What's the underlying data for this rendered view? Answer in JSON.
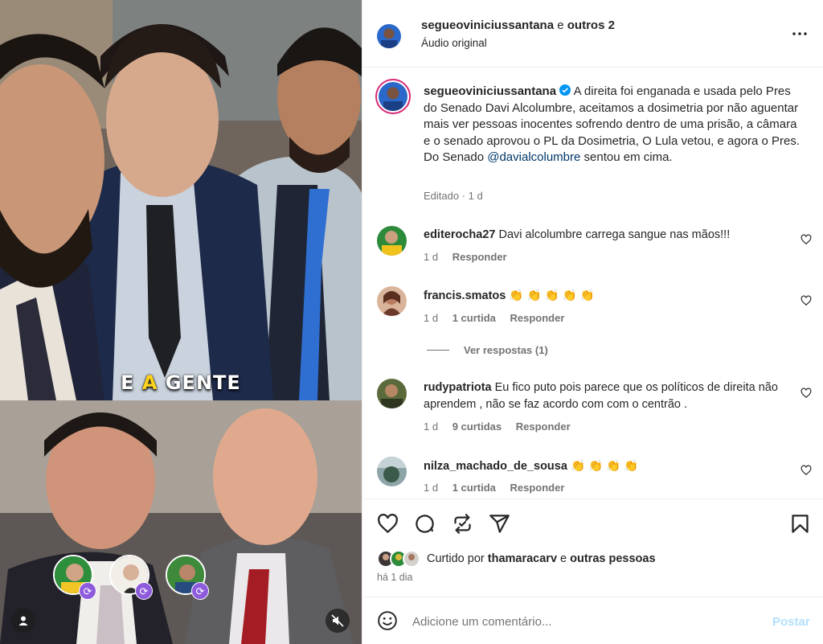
{
  "media": {
    "caption_prefix": "E ",
    "caption_highlight": "A",
    "caption_suffix": " GENTE",
    "collab_badge_icon": "repost-icon"
  },
  "header": {
    "username": "segueoviniciussantana",
    "joiner": " e ",
    "others": "outros 2",
    "audio": "Áudio original",
    "more_icon": "more-horizontal-icon"
  },
  "post_caption": {
    "username": "segueoviniciussantana",
    "verified_icon": "verified-badge-icon",
    "text_before": "A direita foi enganada e usada pelo Pres do Senado Davi Alcolumbre, aceitamos a dosimetria por não aguentar mais ver pessoas inocentes sofrendo dentro de uma prisão, a câmara e o senado aprovou o PL da Dosimetria, O Lula vetou, e agora o Pres. Do Senado ",
    "mention": "@davialcolumbre",
    "text_after": " sentou em cima.",
    "edited": "Editado · 1 d"
  },
  "comments": [
    {
      "username": "editerocha27",
      "text": "Davi alcolumbre carrega sangue nas mãos!!!",
      "time": "1 d",
      "likes": "",
      "reply": "Responder",
      "emoji_count": 0
    },
    {
      "username": "francis.smatos",
      "text": "👏 👏 👏 👏 👏",
      "time": "1 d",
      "likes": "1 curtida",
      "reply": "Responder",
      "emoji_count": 5
    },
    {
      "username": "rudypatriota",
      "text": "Eu fico puto pois parece que os políticos de direita não aprendem , não se faz acordo com com o centrão .",
      "time": "1 d",
      "likes": "9 curtidas",
      "reply": "Responder",
      "emoji_count": 0
    },
    {
      "username": "nilza_machado_de_sousa",
      "text": "👏 👏 👏 👏",
      "time": "1 d",
      "likes": "1 curtida",
      "reply": "Responder",
      "emoji_count": 4
    }
  ],
  "view_replies": "Ver respostas (1)",
  "actions": {
    "like_icon": "heart-icon",
    "comment_icon": "comment-icon",
    "repost_icon": "repost-icon",
    "share_icon": "share-icon",
    "save_icon": "bookmark-icon"
  },
  "likes": {
    "prefix": "Curtido por ",
    "user": "thamaracarv",
    "joiner": " e ",
    "others": "outras pessoas",
    "time": "há 1 dia"
  },
  "add_comment": {
    "placeholder": "Adicione um comentário...",
    "post_label": "Postar",
    "emoji_icon": "emoji-smile-icon"
  },
  "colors": {
    "accent": "#0095f6",
    "post_disabled": "#b2dffc",
    "mention": "#00376b",
    "verified": "#0095f6",
    "text": "#262626",
    "muted": "#737373"
  }
}
